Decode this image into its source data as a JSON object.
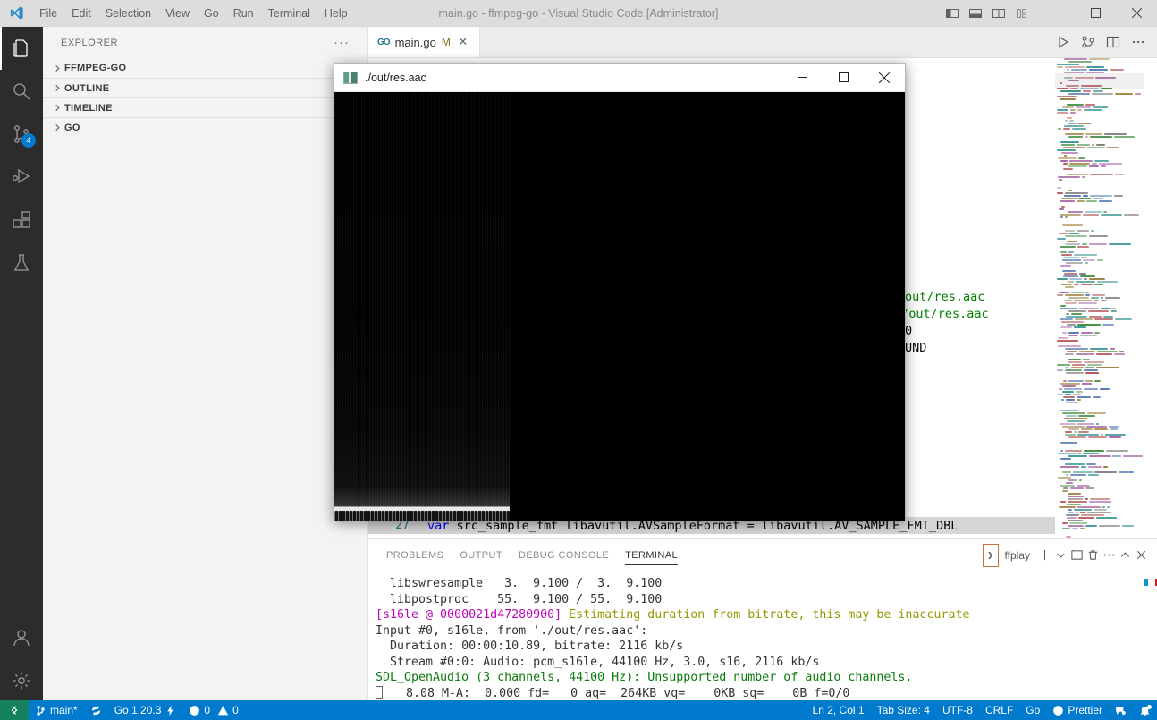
{
  "window": {
    "title": "main.go - ffmpeg-go - Visual Studio Code [Administrator]",
    "minimize": "—",
    "maximize": "☐",
    "close": "✕"
  },
  "menubar": {
    "items": [
      {
        "label": "File"
      },
      {
        "label": "Edit"
      },
      {
        "label": "Selection"
      },
      {
        "label": "View"
      },
      {
        "label": "Go"
      },
      {
        "label": "Run"
      },
      {
        "label": "Terminal"
      },
      {
        "label": "Help"
      }
    ]
  },
  "activitybar": {
    "items": [
      {
        "name": "explorer",
        "badge": ""
      },
      {
        "name": "search",
        "badge": ""
      },
      {
        "name": "source-control",
        "badge": "4"
      },
      {
        "name": "run-and-debug",
        "badge": ""
      },
      {
        "name": "extensions",
        "badge": ""
      },
      {
        "name": "testing",
        "badge": ""
      }
    ],
    "bottom": [
      {
        "name": "accounts"
      },
      {
        "name": "manage"
      }
    ]
  },
  "sidebar": {
    "header": "EXPLORER",
    "more": "···",
    "sections": [
      {
        "label": "FFMPEG-GO",
        "expanded": false
      },
      {
        "label": "OUTLINE",
        "expanded": false
      },
      {
        "label": "TIMELINE",
        "expanded": false
      },
      {
        "label": "GO",
        "expanded": false
      }
    ]
  },
  "editor": {
    "tab": {
      "icon_label": "GO",
      "filename": "main.go",
      "modified": "M",
      "close": "✕"
    },
    "actions": [
      "run-button",
      "split-editor-down",
      "split-editor-right",
      "more-actions"
    ],
    "visible_code_fragments": [
      "out/res.aac",
      "./out/res.aac",
      "0",
      "UND"
    ],
    "line27": {
      "number": "27",
      "kw": "var",
      "rest": " src_sample_fmt libavutil.AVSampleFormat = libavutil.AV_SAMPLE_FMT_DBL"
    }
  },
  "ffplay": {
    "title": "./out/res.aac",
    "minimize": "—",
    "maximize": "☐",
    "close": "✕"
  },
  "panel": {
    "tabs": [
      {
        "label": "PROBLEMS",
        "active": false
      },
      {
        "label": "OUTPUT",
        "active": false
      },
      {
        "label": "DEBUG CONSOLE",
        "active": false
      },
      {
        "label": "TERMINAL",
        "active": true
      }
    ],
    "terminal_instance": "ffplay",
    "prompt_glyph": "❯",
    "actions": [
      "new-terminal",
      "terminal-dropdown",
      "split-terminal",
      "kill-terminal",
      "more-actions",
      "maximize-panel",
      "close-panel"
    ],
    "terminal_lines": [
      [
        {
          "t": "  libswresample   3.  9.100 /  3.  9.100",
          "c": "t-white"
        }
      ],
      [
        {
          "t": "  libpostproc    55.  9.100 / 55.  9.100",
          "c": "t-white"
        }
      ],
      [
        {
          "t": "[s16le @ 0000021d47280900]",
          "c": "t-magenta"
        },
        {
          "t": " Estimating duration from bitrate, this may be inaccurate",
          "c": "t-yellow"
        }
      ],
      [
        {
          "t": "Input #0, s16le, from './out/res.aac':",
          "c": "t-white"
        }
      ],
      [
        {
          "t": "  Duration: 00:00:10.89, bitrate: 2116 kb/s",
          "c": "t-white"
        }
      ],
      [
        {
          "t": "  Stream #0:0: Audio: pcm_s16le, 44100 Hz, 3.0, s16, 2116 kb/s",
          "c": "t-white"
        }
      ],
      [
        {
          "t": "SDL_OpenAudio (3 channels, 44100 Hz): Unsupported number of audio channels.",
          "c": "t-green"
        }
      ],
      [
        {
          "t": "   8.08 M-A:  0.000 fd=   0 aq=  264KB vq=    0KB sq=    0B f=0/0",
          "c": "t-white",
          "cursor": true
        }
      ]
    ]
  },
  "statusbar": {
    "remote_icon": "remote-window-icon",
    "left": [
      {
        "name": "branch",
        "label": "main*",
        "icon": "source-control-icon"
      },
      {
        "name": "sync",
        "label": "",
        "icon": "sync-icon"
      },
      {
        "name": "go-version",
        "label": "Go 1.20.3",
        "icon": "lightning-icon"
      },
      {
        "name": "errors-warnings",
        "label": "0",
        "label2": "0",
        "icon": "error-icon"
      }
    ],
    "right": [
      {
        "name": "cursor-position",
        "label": "Ln 2, Col 1"
      },
      {
        "name": "tab-size",
        "label": "Tab Size: 4"
      },
      {
        "name": "encoding",
        "label": "UTF-8"
      },
      {
        "name": "eol",
        "label": "CRLF"
      },
      {
        "name": "language-mode",
        "label": "Go"
      },
      {
        "name": "prettier",
        "label": "Prettier",
        "icon": "prettier-icon"
      },
      {
        "name": "feedback",
        "label": "",
        "icon": "feedback-icon"
      },
      {
        "name": "notifications",
        "label": "",
        "icon": "bell-icon"
      }
    ]
  },
  "colors": {
    "accent": "#007acc",
    "remote": "#16825d",
    "titlebar": "#dddddd",
    "sidebar": "#f3f3f3",
    "activitybar": "#2c2c2c",
    "terminal_magenta": "#bc05bc",
    "terminal_yellow": "#949800",
    "terminal_green": "#0c7a0c"
  }
}
